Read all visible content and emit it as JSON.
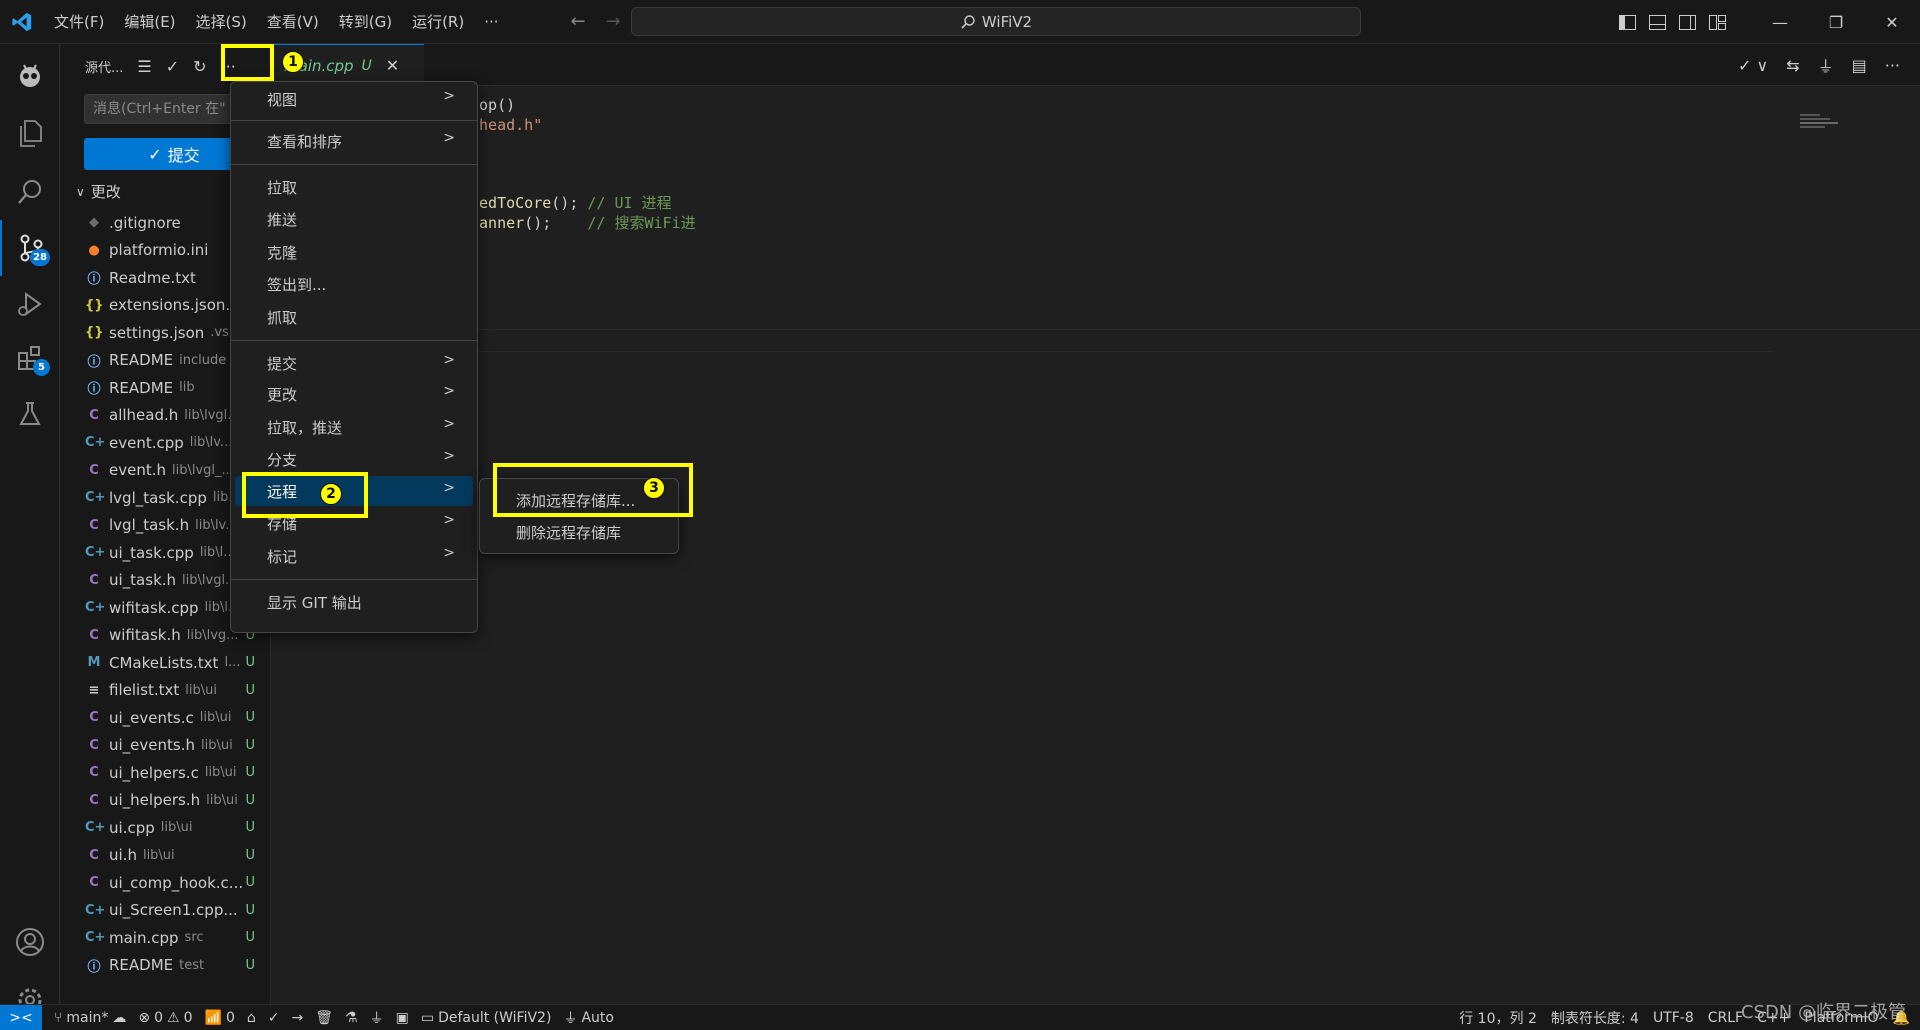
{
  "title_bar": {
    "menus": [
      "文件(F)",
      "编辑(E)",
      "选择(S)",
      "查看(V)",
      "转到(G)",
      "运行(R)",
      "···"
    ],
    "search_text": "WiFiV2"
  },
  "activity_bar": {
    "scm_badge": "28",
    "extensions_badge": "5"
  },
  "sidebar": {
    "title": "源代...",
    "message_placeholder": "消息(Ctrl+Enter 在\"",
    "commit_label": "提交",
    "changes_label": "更改",
    "files": [
      {
        "icon": "◆",
        "icon_color": "#6c6c6c",
        "name": ".gitignore",
        "path": "",
        "status": ""
      },
      {
        "icon": "●",
        "icon_color": "#f5822a",
        "name": "platformio.ini",
        "path": "",
        "status": ""
      },
      {
        "icon": "ⓘ",
        "icon_color": "#75beff",
        "name": "Readme.txt",
        "path": "",
        "status": ""
      },
      {
        "icon": "{}",
        "icon_color": "#cbcb41",
        "name": "extensions.json...",
        "path": "",
        "status": ""
      },
      {
        "icon": "{}",
        "icon_color": "#cbcb41",
        "name": "settings.json",
        "path": ".vs...",
        "status": ""
      },
      {
        "icon": "ⓘ",
        "icon_color": "#75beff",
        "name": "README",
        "path": "include",
        "status": ""
      },
      {
        "icon": "ⓘ",
        "icon_color": "#75beff",
        "name": "README",
        "path": "lib",
        "status": ""
      },
      {
        "icon": "C",
        "icon_color": "#a074c4",
        "name": "allhead.h",
        "path": "lib\\lvgl...",
        "status": ""
      },
      {
        "icon": "C+",
        "icon_color": "#519aba",
        "name": "event.cpp",
        "path": "lib\\lv...",
        "status": ""
      },
      {
        "icon": "C",
        "icon_color": "#a074c4",
        "name": "event.h",
        "path": "lib\\lvgl_...",
        "status": ""
      },
      {
        "icon": "C+",
        "icon_color": "#519aba",
        "name": "lvgl_task.cpp",
        "path": "lib...",
        "status": ""
      },
      {
        "icon": "C",
        "icon_color": "#a074c4",
        "name": "lvgl_task.h",
        "path": "lib\\lv...",
        "status": ""
      },
      {
        "icon": "C+",
        "icon_color": "#519aba",
        "name": "ui_task.cpp",
        "path": "lib\\l...",
        "status": ""
      },
      {
        "icon": "C",
        "icon_color": "#a074c4",
        "name": "ui_task.h",
        "path": "lib\\lvgl...",
        "status": ""
      },
      {
        "icon": "C+",
        "icon_color": "#519aba",
        "name": "wifitask.cpp",
        "path": "lib\\l...",
        "status": ""
      },
      {
        "icon": "C",
        "icon_color": "#a074c4",
        "name": "wifitask.h",
        "path": "lib\\lvg...",
        "status": "U"
      },
      {
        "icon": "M",
        "icon_color": "#519aba",
        "name": "CMakeLists.txt",
        "path": "l...",
        "status": "U"
      },
      {
        "icon": "≡",
        "icon_color": "#cccccc",
        "name": "filelist.txt",
        "path": "lib\\ui",
        "status": "U"
      },
      {
        "icon": "C",
        "icon_color": "#a074c4",
        "name": "ui_events.c",
        "path": "lib\\ui",
        "status": "U"
      },
      {
        "icon": "C",
        "icon_color": "#a074c4",
        "name": "ui_events.h",
        "path": "lib\\ui",
        "status": "U"
      },
      {
        "icon": "C",
        "icon_color": "#a074c4",
        "name": "ui_helpers.c",
        "path": "lib\\ui",
        "status": "U"
      },
      {
        "icon": "C",
        "icon_color": "#a074c4",
        "name": "ui_helpers.h",
        "path": "lib\\ui",
        "status": "U"
      },
      {
        "icon": "C+",
        "icon_color": "#519aba",
        "name": "ui.cpp",
        "path": "lib\\ui",
        "status": "U"
      },
      {
        "icon": "C",
        "icon_color": "#a074c4",
        "name": "ui.h",
        "path": "lib\\ui",
        "status": "U"
      },
      {
        "icon": "C",
        "icon_color": "#a074c4",
        "name": "ui_comp_hook.c...",
        "path": "",
        "status": "U"
      },
      {
        "icon": "C+",
        "icon_color": "#519aba",
        "name": "ui_Screen1.cpp...",
        "path": "",
        "status": "U"
      },
      {
        "icon": "C+",
        "icon_color": "#519aba",
        "name": "main.cpp",
        "path": "src",
        "status": "U"
      },
      {
        "icon": "ⓘ",
        "icon_color": "#75beff",
        "name": "README",
        "path": "test",
        "status": "U"
      }
    ]
  },
  "tab": {
    "name": "main.cpp",
    "status": "U"
  },
  "editor": {
    "lines": [
      {
        "text": "oop()",
        "color": "#cccccc"
      },
      {
        "text": "lhead.h\"",
        "color": "#ce9178"
      },
      {
        "text": "nedToCore",
        "color": "#dcdcaa"
      },
      {
        "text": "(); ",
        "color": "#cccccc"
      },
      {
        "text": "// UI 进程",
        "color": "#6a9955"
      },
      {
        "text": "canner",
        "color": "#dcdcaa"
      },
      {
        "text": "();    ",
        "color": "#cccccc"
      },
      {
        "text": "// 搜索WiFi进",
        "color": "#6a9955"
      }
    ]
  },
  "context_menu": {
    "items": [
      {
        "label": "视图",
        "submenu": true
      },
      {
        "label": "查看和排序",
        "submenu": true
      },
      {
        "label": "拉取",
        "submenu": false
      },
      {
        "label": "推送",
        "submenu": false
      },
      {
        "label": "克隆",
        "submenu": false
      },
      {
        "label": "签出到...",
        "submenu": false
      },
      {
        "label": "抓取",
        "submenu": false
      },
      {
        "label": "提交",
        "submenu": true
      },
      {
        "label": "更改",
        "submenu": true
      },
      {
        "label": "拉取，推送",
        "submenu": true
      },
      {
        "label": "分支",
        "submenu": true
      },
      {
        "label": "远程",
        "submenu": true
      },
      {
        "label": "存储",
        "submenu": true
      },
      {
        "label": "标记",
        "submenu": true
      },
      {
        "label": "显示 GIT 输出",
        "submenu": false
      }
    ]
  },
  "remote_submenu": {
    "items": [
      "添加远程存储库...",
      "删除远程存储库"
    ]
  },
  "annotations": [
    "1",
    "2",
    "3"
  ],
  "status_bar": {
    "branch": "main*",
    "errors": "0",
    "warnings": "0",
    "ports": "0",
    "env": "Default (WiFiV2)",
    "auto": "Auto",
    "position": "行 10，列 2",
    "tab_size": "制表符长度: 4",
    "encoding": "UTF-8",
    "eol": "CRLF",
    "lang": "C++",
    "platform": "PlatformIO"
  },
  "watermark": "CSDN @临界二极管"
}
